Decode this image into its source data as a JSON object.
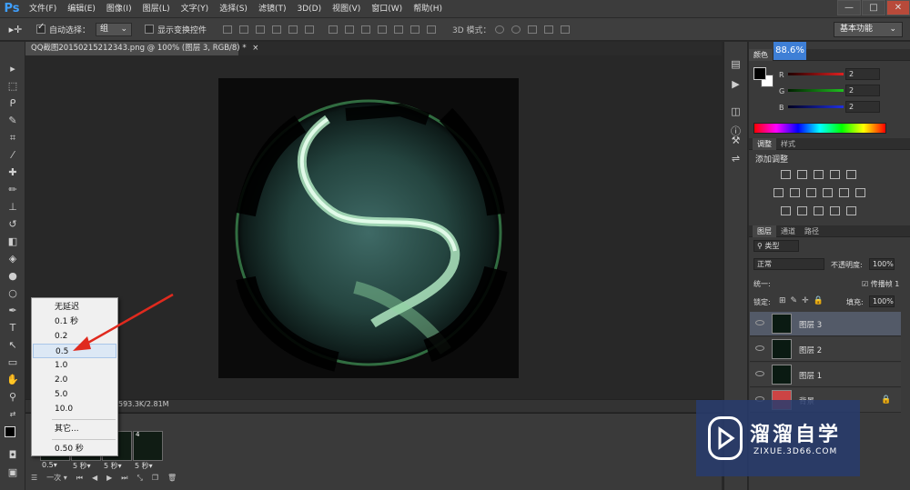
{
  "app": {
    "logo": "Ps"
  },
  "menu": [
    "文件(F)",
    "编辑(E)",
    "图像(I)",
    "图层(L)",
    "文字(Y)",
    "选择(S)",
    "滤镜(T)",
    "3D(D)",
    "视图(V)",
    "窗口(W)",
    "帮助(H)"
  ],
  "window_controls": {
    "minimize": "—",
    "restore": "□",
    "close": "✕"
  },
  "options": {
    "auto_select_label": "自动选择：",
    "auto_select_value": "组",
    "show_transform_label": "显示变换控件",
    "mode3d_label": "3D 模式：",
    "workspace": "基本功能"
  },
  "document": {
    "tab_title": "QQ截图20150215212343.png @ 100% (图层 3, RGB/8) *"
  },
  "status": {
    "doc_size": "593.3K/2.81M"
  },
  "zoom_badge": "88.6%",
  "delay_menu": {
    "items": [
      "无延迟",
      "0.1 秒",
      "0.2",
      "0.5",
      "1.0",
      "2.0",
      "5.0",
      "10.0"
    ],
    "other": "其它...",
    "current": "0.50 秒",
    "selected_index": 3
  },
  "timeline": {
    "frames": [
      {
        "num": "1",
        "delay": "0.5▾"
      },
      {
        "num": "2",
        "delay": "5 秒▾"
      },
      {
        "num": "3",
        "delay": "5 秒▾"
      },
      {
        "num": "4",
        "delay": "5 秒▾"
      }
    ],
    "loop": "一次"
  },
  "color_panel": {
    "tabs": [
      "颜色"
    ],
    "channels": [
      {
        "label": "R",
        "value": "2",
        "color": "#e02020"
      },
      {
        "label": "G",
        "value": "2",
        "color": "#20c020"
      },
      {
        "label": "B",
        "value": "2",
        "color": "#2030e0"
      }
    ]
  },
  "adjust_panel": {
    "tabs": [
      "调整",
      "样式"
    ],
    "title": "添加调整"
  },
  "layers_panel": {
    "tabs": [
      "图层",
      "通道",
      "路径"
    ],
    "filter": "类型",
    "blend_mode": "正常",
    "opacity_label": "不透明度:",
    "opacity_value": "100%",
    "unify_label": "统一:",
    "propagate_label": "传播帧 1",
    "lock_label": "锁定:",
    "fill_label": "填充:",
    "fill_value": "100%",
    "layers": [
      {
        "name": "图层 3",
        "active": true
      },
      {
        "name": "图层 2",
        "active": false
      },
      {
        "name": "图层 1",
        "active": false
      },
      {
        "name": "背景",
        "active": false
      }
    ]
  },
  "watermark": {
    "title": "溜溜自学",
    "url": "ZIXUE.3D66.COM"
  }
}
